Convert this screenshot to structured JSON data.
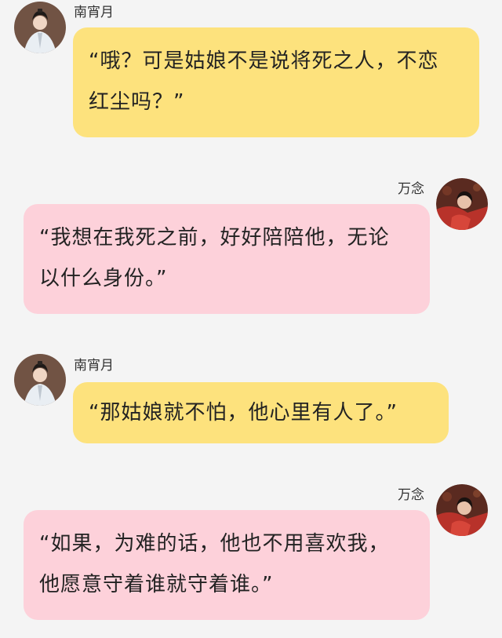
{
  "messages": [
    {
      "sender": "南宵月",
      "side": "left",
      "lines": [
        "“哦？可是姑娘不是说将死之人，不恋",
        "红尘吗？”"
      ]
    },
    {
      "sender": "万念",
      "side": "right",
      "lines": [
        "“我想在我死之前，好好陪陪他，无论",
        "以什么身份。”"
      ]
    },
    {
      "sender": "南宵月",
      "side": "left",
      "lines": [
        "“那姑娘就不怕，他心里有人了。”"
      ]
    },
    {
      "sender": "万念",
      "side": "right",
      "lines": [
        "“如果，为难的话，他也不用喜欢我，",
        "他愿意守着谁就守着谁。”"
      ]
    }
  ],
  "colors": {
    "background": "#f4f4f4",
    "left_bubble": "#fde27d",
    "right_bubble": "#fdd1da",
    "text": "#222222"
  },
  "icons": {
    "left_avatar": "male-avatar-portrait",
    "right_avatar": "female-avatar-portrait"
  }
}
